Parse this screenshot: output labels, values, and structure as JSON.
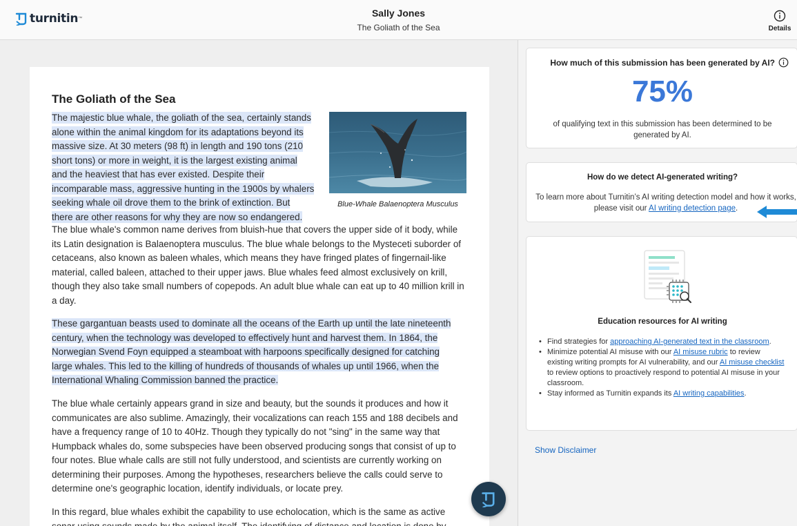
{
  "header": {
    "logo_text": "turnitin",
    "student_name": "Sally Jones",
    "doc_title": "The Goliath of the Sea",
    "details_label": "Details"
  },
  "document": {
    "heading": "The Goliath of the Sea",
    "p1_lines": [
      "The majestic blue whale, the goliath of the sea, certainly stands",
      "alone within the animal kingdom for its adaptations beyond its",
      "massive size. At 30 meters (98 ft) in length and 190 tons (210",
      "short tons) or more in weight, it is the largest existing animal",
      "and the heaviest that has ever existed. Despite their",
      "incomparable mass, aggressive hunting in the 1900s by whalers",
      "seeking whale oil drove them to the brink of extinction. But",
      "there are other reasons for why they are now so endangered."
    ],
    "caption": "Blue-Whale Balaenoptera Musculus",
    "p2": "The blue whale's common name derives from bluish-hue that covers the upper side of it body, while its Latin designation is Balaenoptera musculus. The blue whale belongs to the Mysteceti suborder of cetaceans, also known as baleen whales, which means they have fringed plates of fingernail-like material, called baleen, attached to their upper jaws. Blue whales feed almost exclusively on krill, though they also take small numbers of copepods. An adult blue whale can eat up to 40 million krill in a day.",
    "p3_lines": [
      "These gargantuan beasts used to dominate all the oceans of the Earth up until the late nineteenth",
      "century, when the technology was developed to effectively hunt and harvest them. In 1864, the",
      "Norwegian Svend Foyn equipped a steamboat with harpoons specifically designed for catching",
      "large whales. This led to the killing of hundreds of thousands of whales up until 1966, when the",
      "International Whaling Commission banned the practice."
    ],
    "p4": "The blue whale certainly appears grand in size and beauty, but the sounds it produces and how it communicates are also sublime. Amazingly, their vocalizations can reach 155 and 188 decibels and have a frequency range of 10 to 40Hz. Though they typically do not \"sing\" in the same way that Humpback whales do, some subspecies have been observed producing songs that consist of up to four notes. Blue whale calls are still not fully understood, and scientists are currently working on determining their purposes. Among the hypotheses, researchers believe the calls could serve to determine one's geographic location, identify individuals, or locate prey.",
    "p5": "In this regard, blue whales exhibit the capability to use echolocation, which is the same as active sonar using sounds made by the animal itself. The identifying of distance and location is done by"
  },
  "ai_card": {
    "title": "How much of this submission has been generated by AI?",
    "percent": "75%",
    "percent_value": 75,
    "description": "of qualifying text in this submission has been determined to be generated by AI."
  },
  "detect_card": {
    "title": "How do we detect AI-generated writing?",
    "text_before": "To learn more about Turnitin’s AI writing detection model and how it works, please visit our ",
    "link": "AI writing detection page",
    "text_after": "."
  },
  "edu_card": {
    "title": "Education resources for AI writing",
    "item1_before": "Find strategies for ",
    "item1_link": "approaching AI-generated text in the classroom",
    "item1_after": ".",
    "item2_a": "Minimize potential AI misuse with our ",
    "item2_link1": "AI misuse rubric",
    "item2_b": " to review existing writing prompts for AI vulnerability, and our ",
    "item2_link2": "AI misuse checklist",
    "item2_c": " to review options to proactively respond to potential AI misuse in your classroom.",
    "item3_before": "Stay informed as Turnitin expands its ",
    "item3_link": "AI writing capabilities",
    "item3_after": "."
  },
  "disclaimer": "Show Disclaimer",
  "colors": {
    "accent": "#3b78d8",
    "highlight": "#dbe6f8",
    "link": "#1565c0",
    "fab": "#1f3a4f"
  },
  "icons": {
    "logo": "turnitin-logo-icon",
    "details": "info-circle-icon",
    "fab": "turnitin-fab-icon",
    "arrow": "blue-arrow-icon"
  }
}
